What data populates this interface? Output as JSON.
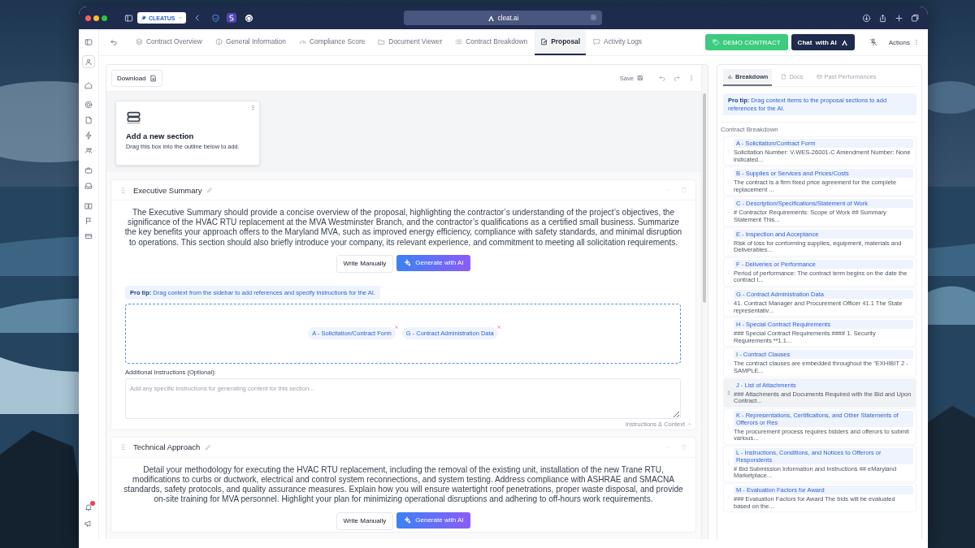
{
  "browser": {
    "tab_group": "CLEATUS",
    "address": "cleat.ai"
  },
  "nav_tabs": [
    {
      "label": "Contract Overview",
      "selected": false
    },
    {
      "label": "General Information",
      "selected": false
    },
    {
      "label": "Compliance Score",
      "selected": false
    },
    {
      "label": "Document Viewer",
      "selected": false
    },
    {
      "label": "Contract Breakdown",
      "selected": false
    },
    {
      "label": "Proposal",
      "selected": true
    },
    {
      "label": "Activity Logs",
      "selected": false
    }
  ],
  "header_actions": {
    "demo": "DEMO CONTRACT",
    "chat": "Chat  with AI",
    "actions": "Actions"
  },
  "toolbar": {
    "download": "Download",
    "save": "Save"
  },
  "add_section": {
    "title": "Add a new section",
    "hint": "Drag this box into the outline below to add."
  },
  "sections": [
    {
      "title": "Executive Summary",
      "description": "The Executive Summary should provide a concise overview of the proposal, highlighting the contractor’s understanding of the project’s objectives, the significance of the HVAC RTU replacement at the MVA Westminster Branch, and the contractor’s qualifications as a certified small business. Summarize the key benefits your approach offers to the Maryland MVA, such as improved energy efficiency, compliance with safety standards, and minimal disruption to operations. This section should also briefly introduce your company, its relevant experience, and commitment to meeting all solicitation requirements.",
      "write_button": "Write Manually",
      "generate_button": "Generate with AI",
      "pro_tip": "**Pro tip:** Drag context from the sidebar to add references and specify instructions for the AI.",
      "chips": [
        "A - Solicitation/Contract Form",
        "G - Contract Administration Data"
      ],
      "instructions_label": "Additional Instructions (Optional):",
      "instructions_placeholder": "Add any specific instructions for generating content for this section...",
      "toggle": "Instructions & Context"
    },
    {
      "title": "Technical Approach",
      "description": "Detail your methodology for executing the HVAC RTU replacement, including the removal of the existing unit, installation of the new Trane RTU, modifications to curbs or ductwork, electrical and control system reconnections, and system testing. Address compliance with ASHRAE and SMACNA standards, safety protocols, and quality assurance measures. Explain how you will ensure watertight roof penetrations, proper waste disposal, and provide on-site training for MVA personnel. Highlight your plan for minimizing operational disruptions and adhering to off-hours work requirements.",
      "write_button": "Write Manually",
      "generate_button": "Generate with AI"
    }
  ],
  "side_panel": {
    "tabs": [
      {
        "label": "Breakdown",
        "selected": true,
        "disabled": false
      },
      {
        "label": "Docs",
        "selected": false,
        "disabled": true
      },
      {
        "label": "Past Performances",
        "selected": false,
        "disabled": true
      }
    ],
    "pro_tip": "**Pro tip:** Drag context items to the proposal sections to add references for the AI.",
    "heading": "Contract Breakdown",
    "items": [
      {
        "title": "A - Solicitation/Contract Form",
        "snippet": "Solicitation Number: V-WES-26001-C Amendment Number: None indicated...",
        "hovered": false
      },
      {
        "title": "B - Supplies or Services and Prices/Costs",
        "snippet": "The contract is a firm fixed price agreement for the complete replacement ...",
        "hovered": false
      },
      {
        "title": "C - Description/Specifications/Statement of Work",
        "snippet": "# Contractor Requirements: Scope of Work ## Summary Statement This...",
        "hovered": false
      },
      {
        "title": "E - Inspection and Acceptance",
        "snippet": "Risk of loss for conforming supplies, equipment, materials and Deliverables...",
        "hovered": false
      },
      {
        "title": "F - Deliveries or Performance",
        "snippet": "Period of performance: The contract term begins on the date the contract i...",
        "hovered": false
      },
      {
        "title": "G - Contract Administration Data",
        "snippet": "41. Contract Manager and Procurement Officer 41.1 The State representativ...",
        "hovered": false
      },
      {
        "title": "H - Special Contract Requirements",
        "snippet": "### Special Contract Requirements #### 1. Security Requirements **1.1...",
        "hovered": false
      },
      {
        "title": "I - Contract Clauses",
        "snippet": "The contract clauses are embedded throughout the \"EXHIBIT 2 - SAMPLE...",
        "hovered": false
      },
      {
        "title": "J - List of Attachments",
        "snippet": "### Attachments and Documents Required with the Bid and Upon Contract...",
        "hovered": true
      },
      {
        "title": "K - Representations, Certifications, and Other Statements of Offerors or Res",
        "snippet": "The procurement process requires bidders and offerors to submit various...",
        "hovered": false
      },
      {
        "title": "L - Instructions, Conditions, and Notices to Offerors or Respondents",
        "snippet": "# Bid Submission Information and Instructions ## eMaryland Marketplace...",
        "hovered": false
      },
      {
        "title": "M - Evaluation Factors for Award",
        "snippet": "### Evaluation Factors for Award The bids will be evaluated based on the...",
        "hovered": false
      }
    ]
  },
  "notifications": {
    "unread": true
  }
}
